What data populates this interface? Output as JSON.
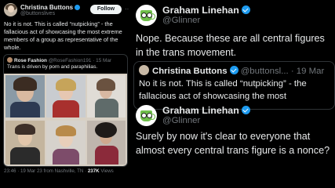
{
  "left_tweet": {
    "name": "Christina Buttons",
    "handle": "@buttonslives",
    "follow_label": "Follow",
    "more_label": "···",
    "text": "No it is not. This is called “nutpicking” - the fallacious act of showcasing the most extreme members of a group as representative of the whole.",
    "quote": {
      "name": "Rose Fashion",
      "handle": "@RoseFashion191 · 15 Mar",
      "text": "Trans is driven by porn and paraphilias."
    },
    "meta_time": "23:46 · 19 Mar 23 from Nashville, TN · ",
    "meta_views": "237K",
    "meta_views_label": " Views"
  },
  "right_tweet1": {
    "name": "Graham Linehan",
    "handle": "@Glinner",
    "text": "Nope. Because these are all central figures in the trans movement.",
    "quote": {
      "name": "Christina Buttons",
      "handle": "@buttonsl... · 19 Mar",
      "text": "No it is not. This is called “nutpicking” - the fallacious act of showcasing the most"
    }
  },
  "right_tweet2": {
    "name": "Graham Linehan",
    "handle": "@Glinner",
    "text": "Surely by now it's clear to everyone that almost every central trans figure is a nonce?"
  },
  "colors": {
    "background": "#000000",
    "text": "#e7e9ea",
    "muted": "#71767b",
    "verified": "#1d9bf0",
    "border": "#2f3336"
  },
  "icons": [
    "verified-badge-icon",
    "avatar-icon",
    "more-icon"
  ]
}
